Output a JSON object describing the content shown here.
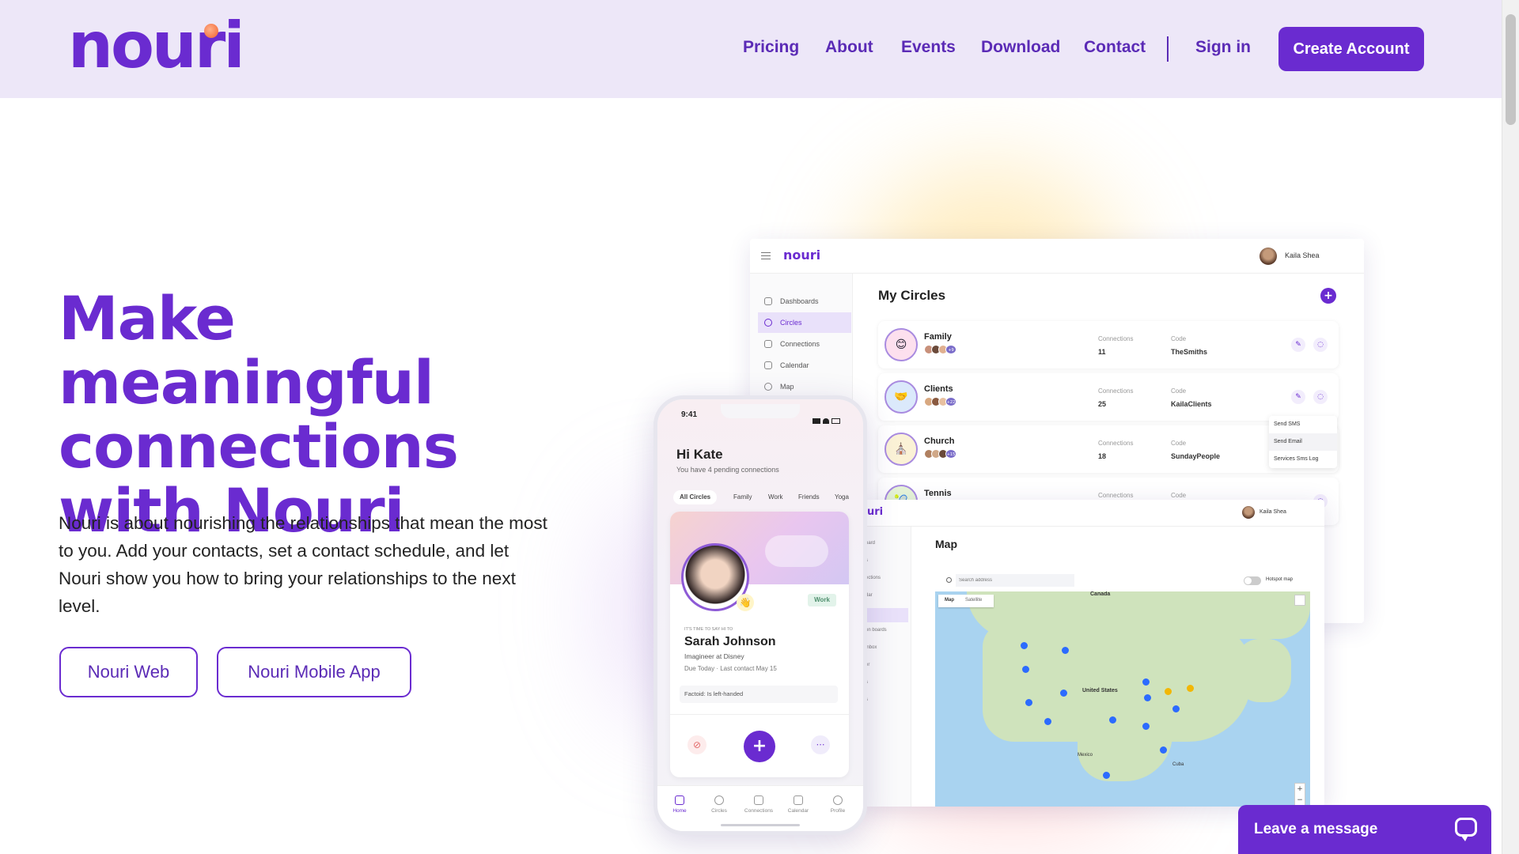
{
  "brand": {
    "logo_text": "nouri",
    "accent": "#6a2bd0",
    "header_bg": "#ede7f8"
  },
  "nav": {
    "items": [
      "Pricing",
      "About",
      "Events",
      "Download",
      "Contact"
    ],
    "sign_in": "Sign in",
    "create_account": "Create Account"
  },
  "hero": {
    "title": "Make meaningful connections with Nouri",
    "description": "Nouri is about nourishing the relationships that mean the most to you. Add your contacts, set a contact schedule, and let Nouri show you how to bring your relationships to the next level.",
    "buttons": [
      "Nouri Web",
      "Nouri Mobile App"
    ]
  },
  "dashboard": {
    "logo": "nouri",
    "user": "Kaila Shea",
    "sidebar": [
      "Dashboards",
      "Circles",
      "Connections",
      "Calendar",
      "Map"
    ],
    "active_item": "Circles",
    "title": "My Circles",
    "columns": {
      "connections": "Connections",
      "code": "Code"
    },
    "circles": [
      {
        "name": "Family",
        "connections": "11",
        "code": "TheSmiths",
        "more": "+9",
        "icon": "smile-icon"
      },
      {
        "name": "Clients",
        "connections": "25",
        "code": "KailaClients",
        "more": "+22",
        "icon": "handshake-icon"
      },
      {
        "name": "Church",
        "connections": "18",
        "code": "SundayPeople",
        "more": "+15",
        "icon": "church-icon"
      },
      {
        "name": "Tennis",
        "connections": "",
        "code": "",
        "more": "",
        "icon": "tennis-icon"
      }
    ],
    "popover": [
      "Send SMS",
      "Send Email",
      "Services Sms Log"
    ]
  },
  "map_window": {
    "logo_fragment": "uri",
    "user": "Kaila Shea",
    "title": "Map",
    "search_placeholder": "Search address",
    "hotspot_label": "Hotspot map",
    "map_types": [
      "Map",
      "Satellite"
    ],
    "labels": [
      "Canada",
      "United States",
      "Mexico",
      "Cuba"
    ],
    "sidebar_fragments": [
      "oard",
      "s",
      "ections",
      "dar",
      "",
      "on boards",
      "inbox",
      "er",
      "s",
      "s"
    ]
  },
  "phone": {
    "time": "9:41",
    "greeting": "Hi Kate",
    "pending": "You have 4 pending connections",
    "chips": [
      "All Circles",
      "Family",
      "Work",
      "Friends",
      "Yoga"
    ],
    "card": {
      "tag": "Work",
      "kicker": "IT'S TIME TO SAY HI TO",
      "name": "Sarah Johnson",
      "role": "Imagineer at Disney",
      "due": "Due Today",
      "last_contact": "Last contact May 15",
      "factoid_label": "Factoid:",
      "factoid": "Is left-handed"
    },
    "tabs": [
      "Home",
      "Circles",
      "Connections",
      "Calendar",
      "Profile"
    ]
  },
  "chat": {
    "label": "Leave a message"
  }
}
